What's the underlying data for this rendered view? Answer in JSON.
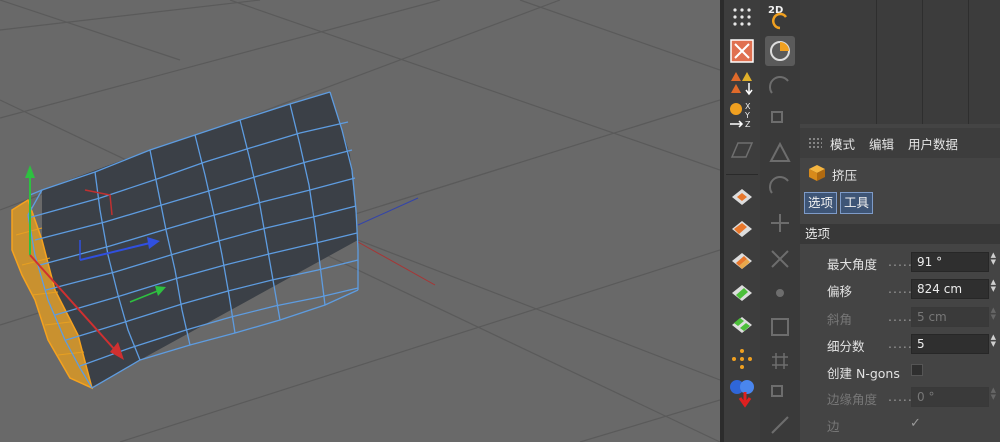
{
  "toolbar": {
    "mode_2d_label": "2D",
    "icons": [
      "point-grid-icon",
      "texture-mode-icon",
      "axis-lock-icon",
      "coordinate-system-icon",
      "workplane-icon"
    ],
    "xyz_label": "XYZ"
  },
  "attributes": {
    "menu": {
      "mode": "模式",
      "edit": "编辑",
      "user_data": "用户数据"
    },
    "object_name": "挤压",
    "tabs": {
      "options": "选项",
      "tool": "工具"
    },
    "section_title": "选项",
    "fields": {
      "max_angle": {
        "label": "最大角度",
        "value": "91 °"
      },
      "offset": {
        "label": "偏移",
        "value": "824 cm"
      },
      "bevel": {
        "label": "斜角",
        "value": "5 cm"
      },
      "subdivision": {
        "label": "细分数",
        "value": "5"
      },
      "ngons": {
        "label": "创建 N-gons"
      },
      "edge_angle": {
        "label": "边缘角度",
        "value": "0 °"
      },
      "edge": {
        "label": "边"
      }
    },
    "dots": "........"
  },
  "colors": {
    "wire": "#5e9ce0",
    "selection": "#f5a21f",
    "accent_tab": "#3e5576"
  }
}
